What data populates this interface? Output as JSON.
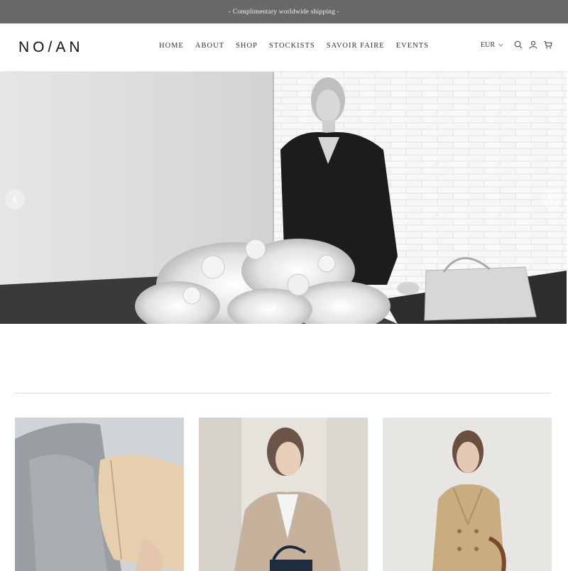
{
  "announcement": {
    "text": "- Complimentary worldwide shipping -"
  },
  "header": {
    "logo": "NO/AN",
    "nav": [
      "HOME",
      "ABOUT",
      "SHOP",
      "STOCKISTS",
      "SAVOIR FAIRE",
      "EVENTS"
    ],
    "currency": "EUR",
    "icons": [
      "search-icon",
      "account-icon",
      "cart-icon"
    ]
  },
  "hero": {
    "slides": 2,
    "active_slide": 2,
    "arrows": [
      "chevron-left-icon",
      "chevron-right-icon"
    ]
  },
  "products": [
    {
      "image": "product-image-bag"
    },
    {
      "image": "product-image-blazer"
    },
    {
      "image": "product-image-trench"
    }
  ],
  "colors": {
    "announce_bg": "#6b6869",
    "text": "#222222"
  }
}
